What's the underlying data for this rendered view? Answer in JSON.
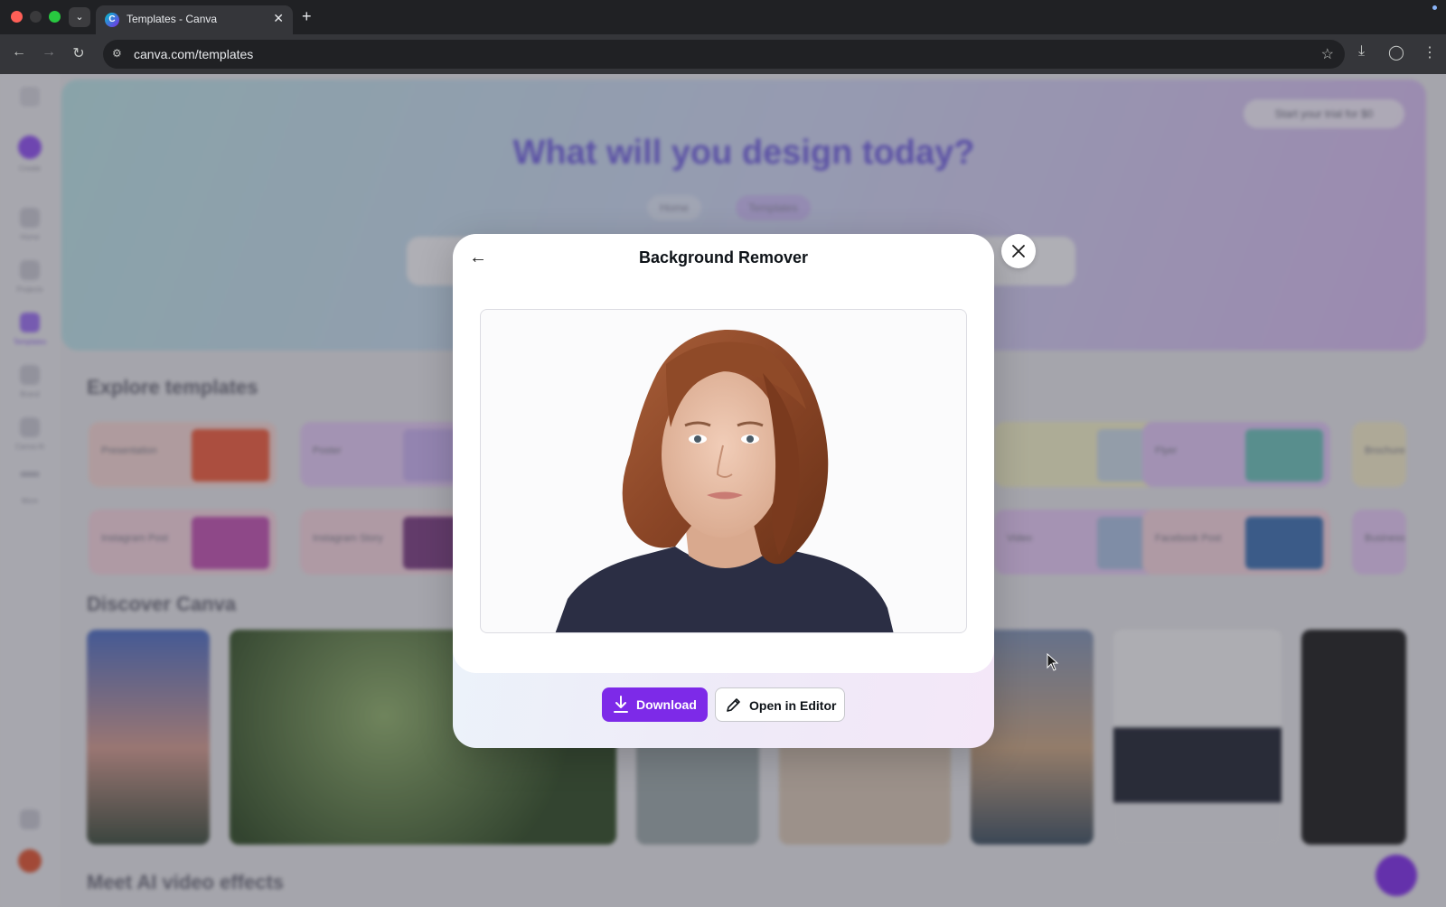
{
  "browser": {
    "tab_title": "Templates - Canva",
    "tab_favicon": "C",
    "url": "canva.com/templates"
  },
  "background": {
    "hero_title": "What will you design today?",
    "hero_tabs": [
      "Home",
      "Templates"
    ],
    "trial_label": "Start your trial for $0",
    "explore_title": "Explore templates",
    "discover_title": "Discover Canva",
    "video_title": "Meet AI video effects",
    "rail_items": [
      "Create",
      "Home",
      "Projects",
      "Templates",
      "Brand",
      "Canva AI",
      "More"
    ],
    "template_cards": [
      "Presentation",
      "Poster",
      "Flyer",
      "Brochure",
      "Instagram Post",
      "Instagram Story",
      "Video",
      "Facebook Post",
      "Business"
    ]
  },
  "modal": {
    "title": "Background Remover",
    "download_label": "Download",
    "editor_label": "Open in Editor"
  },
  "icons": {
    "back": "arrow-left-icon",
    "close": "close-icon",
    "download": "download-icon",
    "edit": "pencil-icon"
  },
  "colors": {
    "brand_purple": "#7d2ae8",
    "hero_title": "#6f5fe0"
  }
}
